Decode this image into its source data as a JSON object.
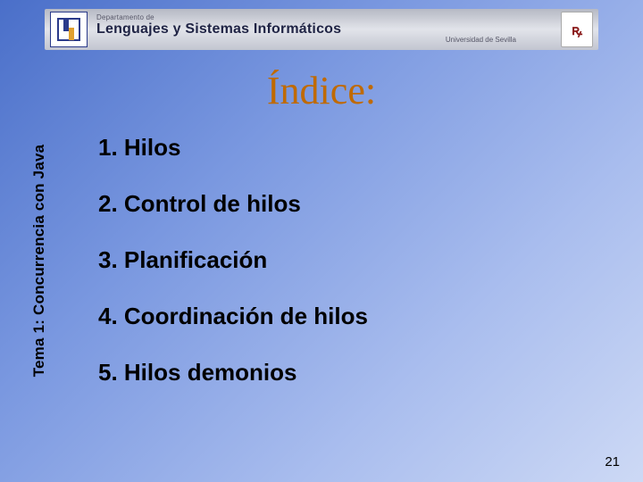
{
  "banner": {
    "department_prefix": "Departamento de",
    "department_main": "Lenguajes y Sistemas Informáticos",
    "university": "Universidad de Sevilla",
    "crest_initials": "ꝶ"
  },
  "title": "Índice:",
  "sidebar": "Tema 1: Concurrencia con Java",
  "items": [
    "1. Hilos",
    "2. Control de hilos",
    "3. Planificación",
    "4. Coordinación de hilos",
    "5. Hilos demonios"
  ],
  "page_number": "21"
}
